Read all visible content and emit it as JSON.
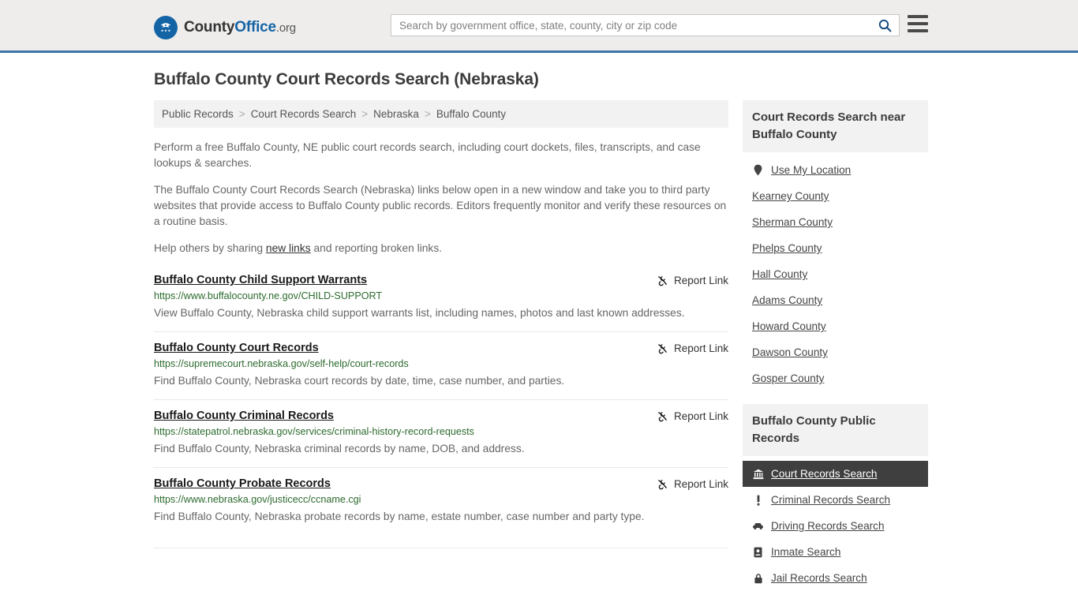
{
  "header": {
    "logo": {
      "name": "CountyOffice.org",
      "part1": "County",
      "part2": "Office",
      "part3": ".org"
    },
    "search": {
      "placeholder": "Search by government office, state, county, city or zip code",
      "value": "",
      "icon": "search-icon"
    },
    "menu_icon": "hamburger-menu-icon",
    "accent_color": "#3c76a8",
    "background_color": "#eeedec"
  },
  "page": {
    "title": "Buffalo County Court Records Search (Nebraska)"
  },
  "breadcrumb": {
    "separator": ">",
    "items": [
      {
        "label": "Public Records"
      },
      {
        "label": "Court Records Search"
      },
      {
        "label": "Nebraska"
      },
      {
        "label": "Buffalo County"
      }
    ]
  },
  "intro": {
    "p1": "Perform a free Buffalo County, NE public court records search, including court dockets, files, transcripts, and case lookups & searches.",
    "p2": "The Buffalo County Court Records Search (Nebraska) links below open in a new window and take you to third party websites that provide access to Buffalo County public records. Editors frequently monitor and verify these resources on a routine basis.",
    "p3_before": "Help others by sharing ",
    "p3_link": "new links",
    "p3_after": " and reporting broken links."
  },
  "results": {
    "report_label": "Report Link",
    "report_icon": "broken-link-icon",
    "items": [
      {
        "title": "Buffalo County Child Support Warrants",
        "url": "https://www.buffalocounty.ne.gov/CHILD-SUPPORT",
        "description": "View Buffalo County, Nebraska child support warrants list, including names, photos and last known addresses."
      },
      {
        "title": "Buffalo County Court Records",
        "url": "https://supremecourt.nebraska.gov/self-help/court-records",
        "description": "Find Buffalo County, Nebraska court records by date, time, case number, and parties."
      },
      {
        "title": "Buffalo County Criminal Records",
        "url": "https://statepatrol.nebraska.gov/services/criminal-history-record-requests",
        "description": "Find Buffalo County, Nebraska criminal records by name, DOB, and address."
      },
      {
        "title": "Buffalo County Probate Records",
        "url": "https://www.nebraska.gov/justicecc/ccname.cgi",
        "description": "Find Buffalo County, Nebraska probate records by name, estate number, case number and party type."
      }
    ]
  },
  "sidebar": {
    "nearby": {
      "heading": "Court Records Search near Buffalo County",
      "items": [
        {
          "label": "Use My Location",
          "icon": "map-pin-icon"
        },
        {
          "label": "Kearney County",
          "icon": ""
        },
        {
          "label": "Sherman County",
          "icon": ""
        },
        {
          "label": "Phelps County",
          "icon": ""
        },
        {
          "label": "Hall County",
          "icon": ""
        },
        {
          "label": "Adams County",
          "icon": ""
        },
        {
          "label": "Howard County",
          "icon": ""
        },
        {
          "label": "Dawson County",
          "icon": ""
        },
        {
          "label": "Gosper County",
          "icon": ""
        }
      ]
    },
    "public_records": {
      "heading": "Buffalo County Public Records",
      "active_index": 0,
      "items": [
        {
          "label": "Court Records Search",
          "icon": "courthouse-icon",
          "active": true
        },
        {
          "label": "Criminal Records Search",
          "icon": "exclamation-icon",
          "active": false
        },
        {
          "label": "Driving Records Search",
          "icon": "car-icon",
          "active": false
        },
        {
          "label": "Inmate Search",
          "icon": "id-badge-icon",
          "active": false
        },
        {
          "label": "Jail Records Search",
          "icon": "lock-icon",
          "active": false
        }
      ]
    }
  }
}
